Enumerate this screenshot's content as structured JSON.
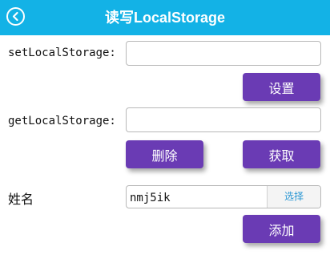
{
  "header": {
    "title": "读写LocalStorage",
    "back_icon": "back-arrow-circle-icon",
    "background": "#13b2e6"
  },
  "set_section": {
    "label": "setLocalStorage:",
    "input_value": "",
    "button_label": "设置"
  },
  "get_section": {
    "label": "getLocalStorage:",
    "input_value": "",
    "delete_label": "删除",
    "get_label": "获取"
  },
  "name_section": {
    "label": "姓名",
    "file_value": "nmj5ik",
    "choose_label": "选择",
    "add_label": "添加"
  },
  "colors": {
    "button": "#6a3bb4",
    "choose_text": "#2a97d3"
  }
}
